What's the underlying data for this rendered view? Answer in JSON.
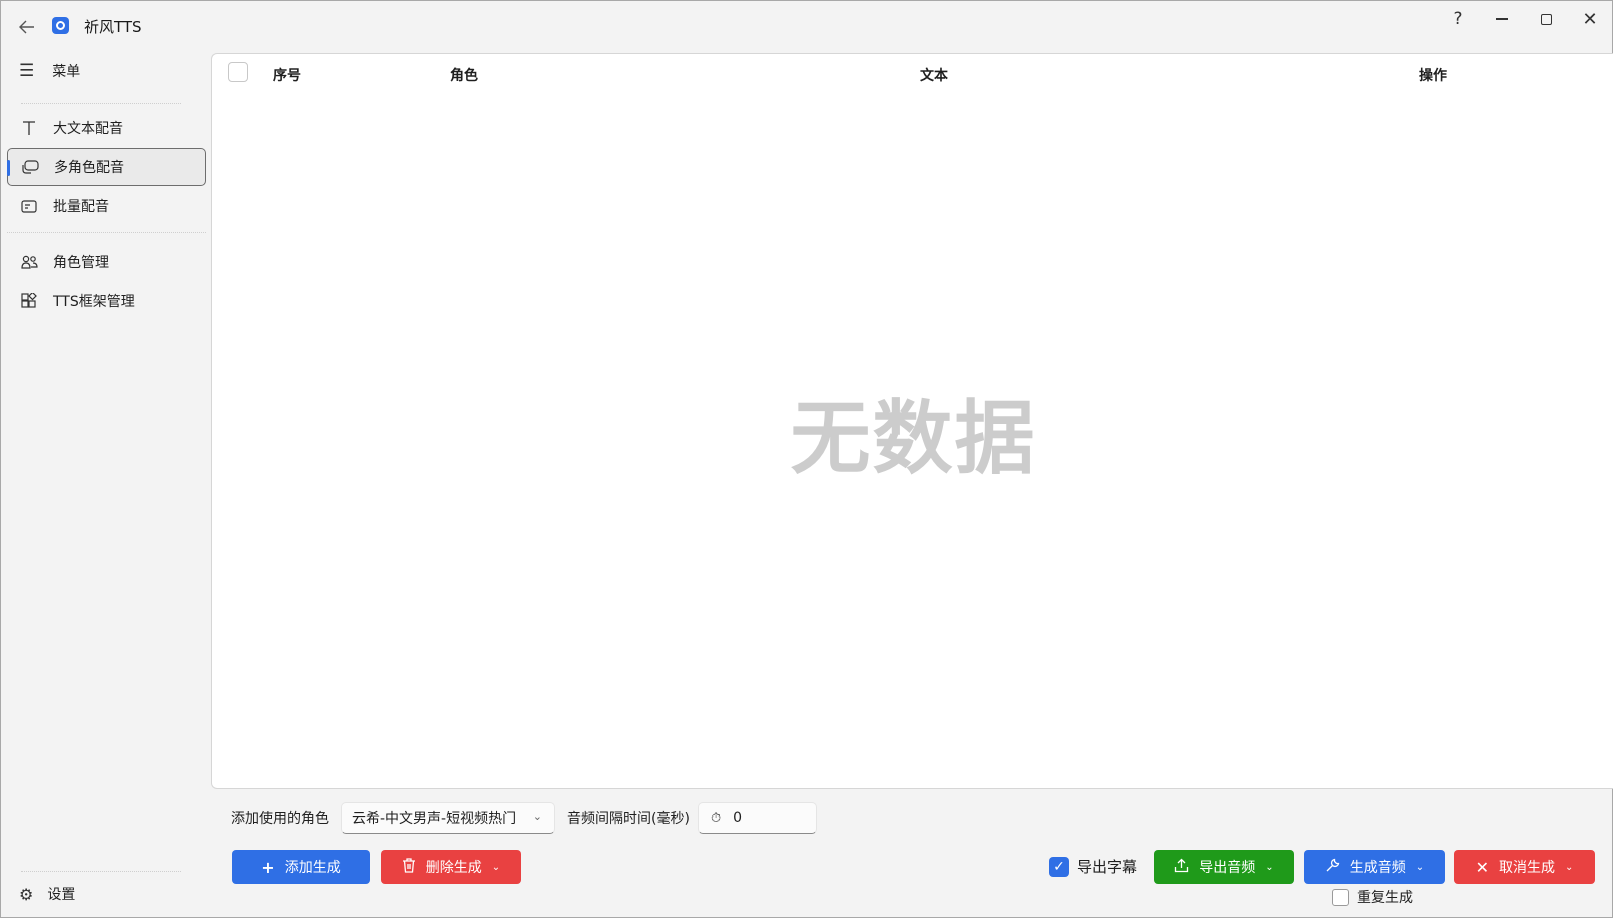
{
  "app": {
    "title": "祈风TTS"
  },
  "window_controls": {
    "help": "?",
    "close": "✕"
  },
  "sidebar": {
    "menu_label": "菜单",
    "items": [
      {
        "label": "大文本配音",
        "icon": "text-T-icon"
      },
      {
        "label": "多角色配音",
        "icon": "chat-bubbles-icon",
        "active": true
      },
      {
        "label": "批量配音",
        "icon": "batch-list-icon"
      },
      {
        "label": "角色管理",
        "icon": "people-icon"
      },
      {
        "label": "TTS框架管理",
        "icon": "apps-grid-icon"
      }
    ],
    "settings_label": "设置"
  },
  "table": {
    "columns": [
      "序号",
      "角色",
      "文本",
      "操作"
    ],
    "empty_text": "无数据"
  },
  "controls": {
    "role_label": "添加使用的角色",
    "role_value": "云希-中文男声-短视频热门",
    "interval_label": "音频间隔时间(毫秒)",
    "interval_value": "0"
  },
  "buttons": {
    "add": "添加生成",
    "delete": "删除生成",
    "export_audio": "导出音频",
    "generate_audio": "生成音频",
    "cancel": "取消生成"
  },
  "checkboxes": {
    "export_subtitles": {
      "label": "导出字幕",
      "checked": true
    },
    "regenerate": {
      "label": "重复生成",
      "checked": false
    }
  },
  "colors": {
    "accent_blue": "#2f6fe5",
    "danger_red": "#e94141",
    "success_green": "#1f9a1a"
  }
}
